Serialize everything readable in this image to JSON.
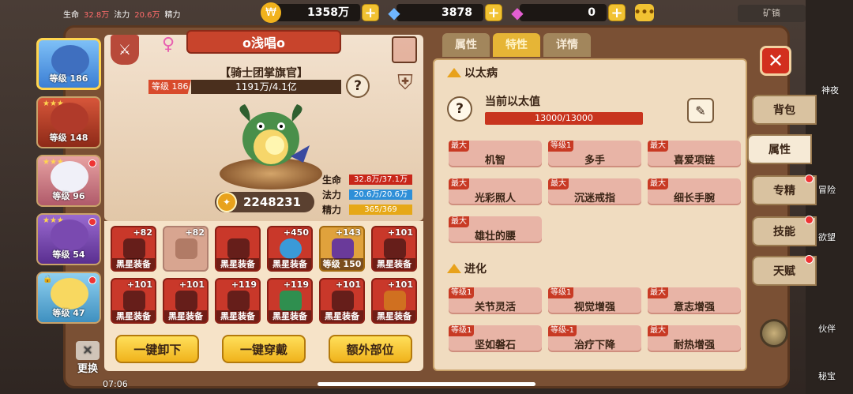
{
  "top_bar": {
    "coins": "1358万",
    "diamonds": "3878",
    "gems": "0",
    "mine_label": "矿镐"
  },
  "status_strip": {
    "hp_label": "生命",
    "hp_value": "32.8万",
    "mp_label": "法力",
    "mp_value": "20.6万",
    "sp_label": "精力"
  },
  "characters": [
    {
      "level": "等级 186",
      "active": true
    },
    {
      "level": "等级 148",
      "active": false
    },
    {
      "level": "等级 96",
      "active": false
    },
    {
      "level": "等级 54",
      "active": false
    },
    {
      "level": "等级 47",
      "active": false
    }
  ],
  "hero": {
    "name": "o浅唱o",
    "title": "【骑士团掌旗官】",
    "level": "等级 186",
    "exp": "1191万/4.1亿",
    "power": "2248231",
    "stats": [
      {
        "label": "生命",
        "value": "32.8万/37.1万",
        "color": "#c8271a"
      },
      {
        "label": "法力",
        "value": "20.6万/20.6万",
        "color": "#2e8fd8"
      },
      {
        "label": "精力",
        "value": "365/369",
        "color": "#e6a817"
      }
    ]
  },
  "equipment": [
    {
      "plus": "+82",
      "tag": "黑星装备",
      "style": "red"
    },
    {
      "plus": "+82",
      "tag": "",
      "style": "faded"
    },
    {
      "plus": "",
      "tag": "黑星装备",
      "style": "red"
    },
    {
      "plus": "+450",
      "tag": "黑星装备",
      "style": "red"
    },
    {
      "plus": "+143",
      "tag": "等级 150",
      "style": "gold"
    },
    {
      "plus": "+101",
      "tag": "黑星装备",
      "style": "red"
    },
    {
      "plus": "+101",
      "tag": "黑星装备",
      "style": "red"
    },
    {
      "plus": "+101",
      "tag": "黑星装备",
      "style": "red"
    },
    {
      "plus": "+119",
      "tag": "黑星装备",
      "style": "red"
    },
    {
      "plus": "+119",
      "tag": "黑星装备",
      "style": "red"
    },
    {
      "plus": "+101",
      "tag": "黑星装备",
      "style": "red"
    },
    {
      "plus": "+101",
      "tag": "黑星装备",
      "style": "red"
    }
  ],
  "buttons": {
    "unequip_all": "一键卸下",
    "equip_all": "一键穿戴",
    "extra_slot": "额外部位",
    "swap": "更换"
  },
  "tabs": [
    "属性",
    "特性",
    "详情"
  ],
  "ether": {
    "section": "以太病",
    "label": "当前以太值",
    "value": "13000/13000"
  },
  "ether_traits": [
    {
      "badge": "最大",
      "name": "机智"
    },
    {
      "badge": "等级1",
      "name": "多手"
    },
    {
      "badge": "最大",
      "name": "喜爱项链"
    },
    {
      "badge": "最大",
      "name": "光彩照人"
    },
    {
      "badge": "最大",
      "name": "沉迷戒指"
    },
    {
      "badge": "最大",
      "name": "细长手腕"
    },
    {
      "badge": "最大",
      "name": "雄壮的腰"
    }
  ],
  "evolution": {
    "section": "进化",
    "traits": [
      {
        "badge": "等级1",
        "name": "关节灵活"
      },
      {
        "badge": "等级1",
        "name": "视觉增强"
      },
      {
        "badge": "最大",
        "name": "意志增强"
      },
      {
        "badge": "等级1",
        "name": "坚如磐石"
      },
      {
        "badge": "等级-1",
        "name": "治疗下降"
      },
      {
        "badge": "最大",
        "name": "耐热增强"
      }
    ]
  },
  "side_tabs": [
    "背包",
    "属性",
    "专精",
    "技能",
    "天赋"
  ],
  "edge_labels": {
    "right_1": "神夜",
    "right_2": "冒险",
    "right_3": "欲望",
    "right_4": "伙伴",
    "right_5": "秘宝",
    "clock": "07:06"
  }
}
